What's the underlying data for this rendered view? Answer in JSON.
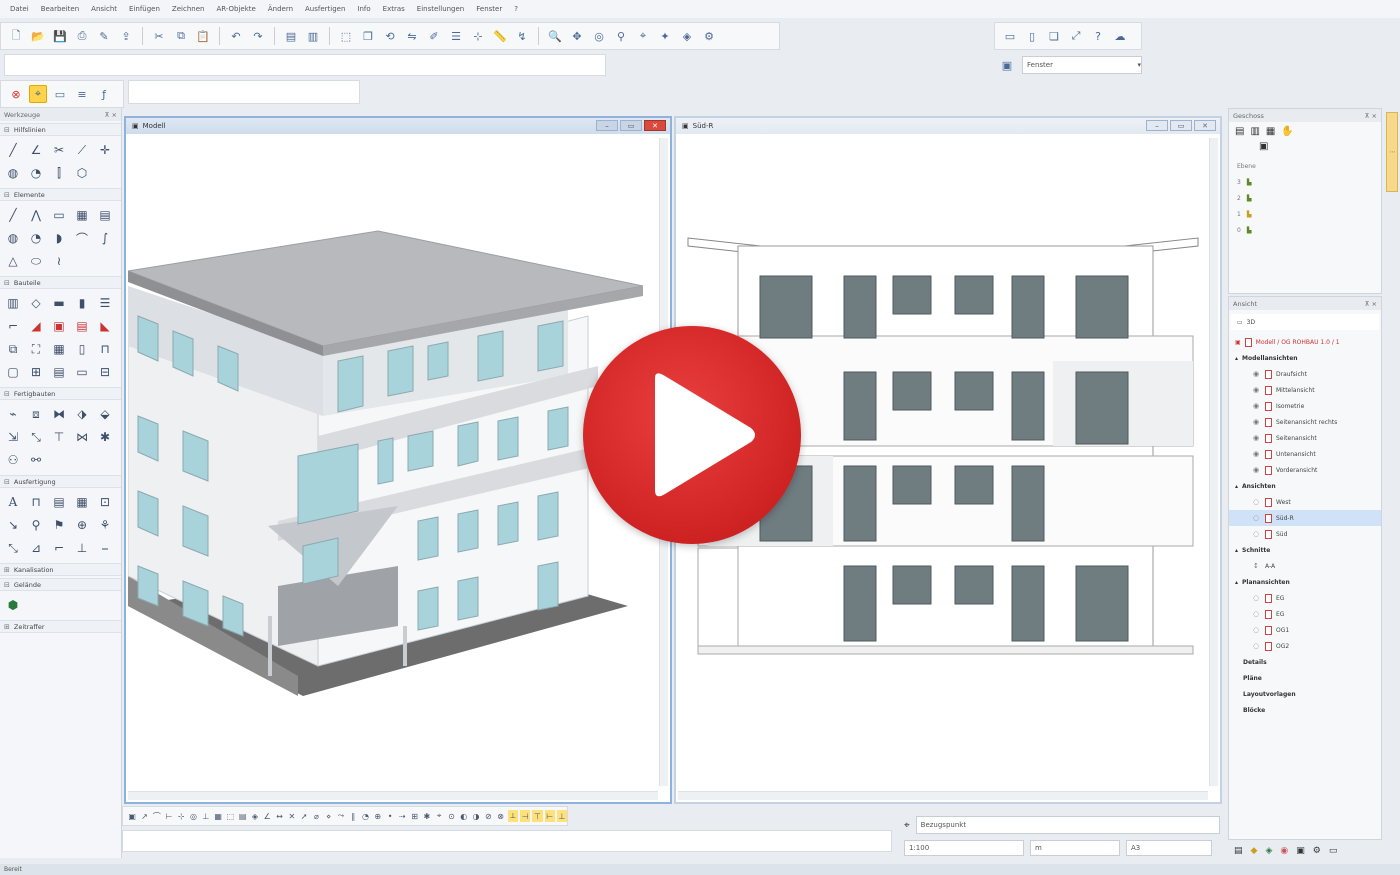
{
  "menu": [
    "Datei",
    "Bearbeiten",
    "Ansicht",
    "Einfügen",
    "Zeichnen",
    "AR-Objekte",
    "Ändern",
    "Ausfertigen",
    "Info",
    "Extras",
    "Einstellungen",
    "Fenster",
    "?"
  ],
  "window_select": {
    "value": "Fenster"
  },
  "left_panel": {
    "title": "Werkzeuge",
    "sections": [
      {
        "name": "Hilfslinien"
      },
      {
        "name": "Elemente"
      },
      {
        "name": "Bauteile"
      },
      {
        "name": "Fertigbauten"
      },
      {
        "name": "Ausfertigung"
      },
      {
        "name": "Kanalisation"
      },
      {
        "name": "Gelände"
      },
      {
        "name": "Zeitraffer"
      }
    ]
  },
  "viewports": {
    "left": {
      "title": "Modell"
    },
    "right": {
      "title": "Süd-R"
    }
  },
  "layers_panel": {
    "title": "Geschoss",
    "header": "Ebene",
    "rows": [
      "3",
      "2",
      "1",
      "0"
    ]
  },
  "view_panel": {
    "title": "Ansicht",
    "root": "3D",
    "model": "Modell / OG ROHBAU 1.0 / 1",
    "categories": [
      {
        "label": "Modellansichten",
        "items": [
          "Draufsicht",
          "Mittelansicht",
          "Isometrie",
          "Seitenansicht rechts",
          "Seitenansicht",
          "Untenansicht",
          "Vorderansicht"
        ]
      },
      {
        "label": "Ansichten",
        "items": [
          "West",
          "Süd-R",
          "Süd"
        ]
      },
      {
        "label": "Schnitte",
        "items": [
          "A-A"
        ]
      },
      {
        "label": "Planansichten",
        "items": [
          "EG",
          "EG",
          "OG1",
          "OG2"
        ]
      }
    ],
    "extra": [
      "Details",
      "Pläne",
      "Layoutvorlagen",
      "Blöcke"
    ]
  },
  "bottom": {
    "point_label": "Bezugspunkt",
    "scale": "1:100",
    "unit": "m",
    "paper": "A3"
  },
  "status": "Bereit",
  "colors": {
    "accent": "#8fb2dd",
    "play": "#d42a2a",
    "highlight": "#ffd34a"
  }
}
